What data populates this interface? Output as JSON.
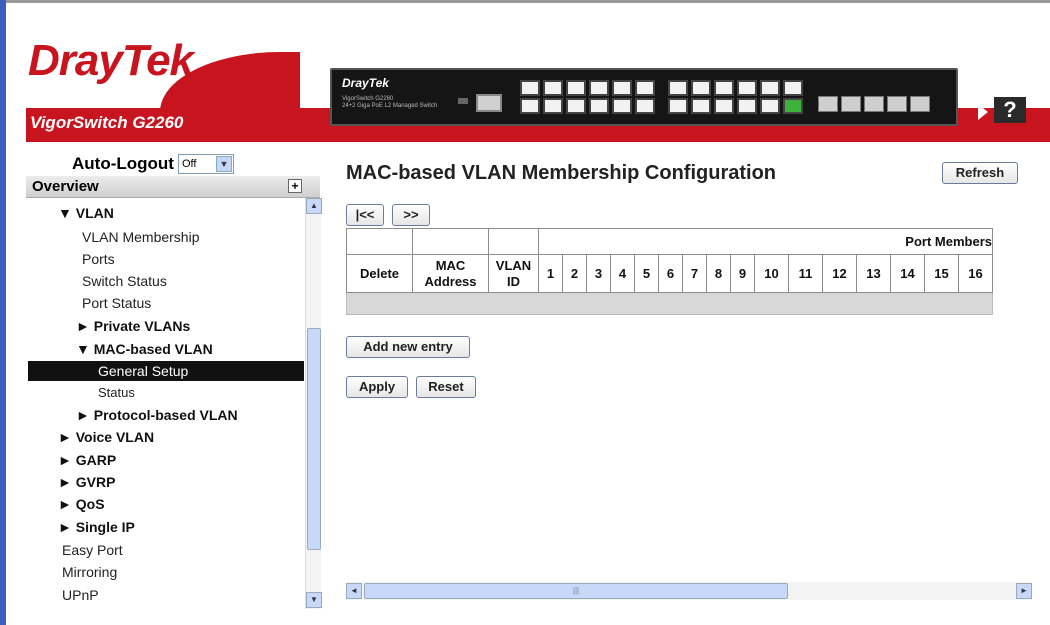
{
  "header": {
    "logo_dray": "Dray",
    "logo_tek": "Tek",
    "model_name": "VigorSwitch G2260",
    "device_brand": "DrayTek",
    "device_model": "VigorSwitch G2260",
    "device_subtitle": "24+2 Giga PoE L2 Managed Switch",
    "help_label": "?"
  },
  "sidebar": {
    "autologout_label": "Auto-Logout",
    "autologout_value": "Off",
    "overview_label": "Overview",
    "items": [
      {
        "label": "▼ VLAN"
      },
      {
        "label": "VLAN Membership"
      },
      {
        "label": "Ports"
      },
      {
        "label": "Switch Status"
      },
      {
        "label": "Port Status"
      },
      {
        "label": "► Private VLANs"
      },
      {
        "label": "▼ MAC-based VLAN"
      },
      {
        "label": "General Setup"
      },
      {
        "label": "Status"
      },
      {
        "label": "► Protocol-based VLAN"
      },
      {
        "label": "► Voice VLAN"
      },
      {
        "label": "► GARP"
      },
      {
        "label": "► GVRP"
      },
      {
        "label": "► QoS"
      },
      {
        "label": "► Single IP"
      },
      {
        "label": "Easy Port"
      },
      {
        "label": "Mirroring"
      },
      {
        "label": "UPnP"
      }
    ]
  },
  "main": {
    "title": "MAC-based VLAN Membership Configuration",
    "refresh_label": "Refresh",
    "first_label": "|<<",
    "next_label": ">>",
    "port_members_label": "Port Members",
    "columns": {
      "delete": "Delete",
      "mac": "MAC Address",
      "vlan": "VLAN ID"
    },
    "ports": [
      "1",
      "2",
      "3",
      "4",
      "5",
      "6",
      "7",
      "8",
      "9",
      "10",
      "11",
      "12",
      "13",
      "14",
      "15",
      "16"
    ],
    "add_entry_label": "Add new entry",
    "apply_label": "Apply",
    "reset_label": "Reset"
  }
}
